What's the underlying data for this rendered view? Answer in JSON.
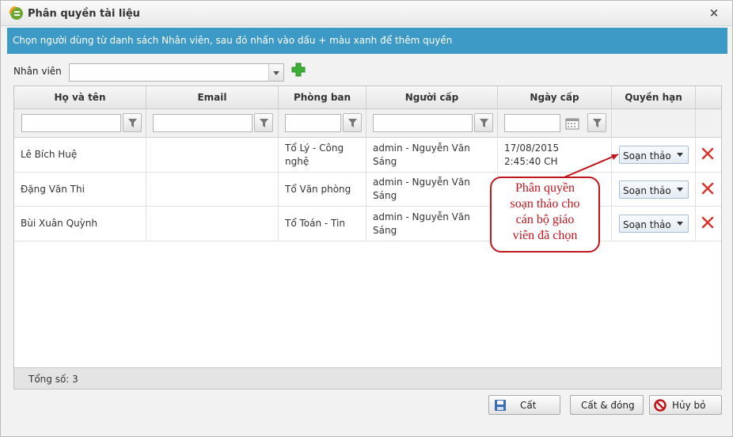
{
  "window": {
    "title": "Phân quyền tài liệu",
    "close_glyph": "×"
  },
  "infobar": {
    "text": "Chọn người dùng từ danh sách Nhân viên, sau đó nhấn vào dấu + màu xanh để thêm quyền"
  },
  "employee": {
    "label": "Nhân viên",
    "value": "",
    "add_icon": "plus-icon"
  },
  "grid": {
    "columns": [
      {
        "label": "Họ và tên"
      },
      {
        "label": "Email"
      },
      {
        "label": "Phòng ban"
      },
      {
        "label": "Người cấp"
      },
      {
        "label": "Ngày cấp"
      },
      {
        "label": "Quyền hạn"
      }
    ],
    "rows": [
      {
        "name": "Lê Bích Huệ",
        "email": "",
        "department": "Tổ Lý - Công nghệ",
        "granted_by": "admin - Nguyễn Văn Sáng",
        "granted_date": "17/08/2015 2:45:40 CH",
        "permission": "Soạn thảo"
      },
      {
        "name": "Đặng Văn Thi",
        "email": "",
        "department": "Tổ Văn phòng",
        "granted_by": "admin - Nguyễn Văn Sáng",
        "granted_date": "",
        "permission": "Soạn thảo"
      },
      {
        "name": "Bùi Xuân Quỳnh",
        "email": "",
        "department": "Tổ Toán - Tin",
        "granted_by": "admin - Nguyễn Văn Sáng",
        "granted_date": "",
        "permission": "Soạn thảo"
      }
    ],
    "footer_total": "Tổng số: 3"
  },
  "buttons": {
    "save": "Cất",
    "save_close": "Cất & đóng",
    "cancel": "Hủy bỏ"
  },
  "annotation": {
    "lines": [
      "Phân quyền",
      "soạn thảo cho",
      "cán bộ giáo",
      "viên đã chọn"
    ],
    "color": "#c0151d"
  },
  "colors": {
    "infobar": "#3d9ac6",
    "delete": "#d9342b",
    "add": "#3cb034"
  }
}
